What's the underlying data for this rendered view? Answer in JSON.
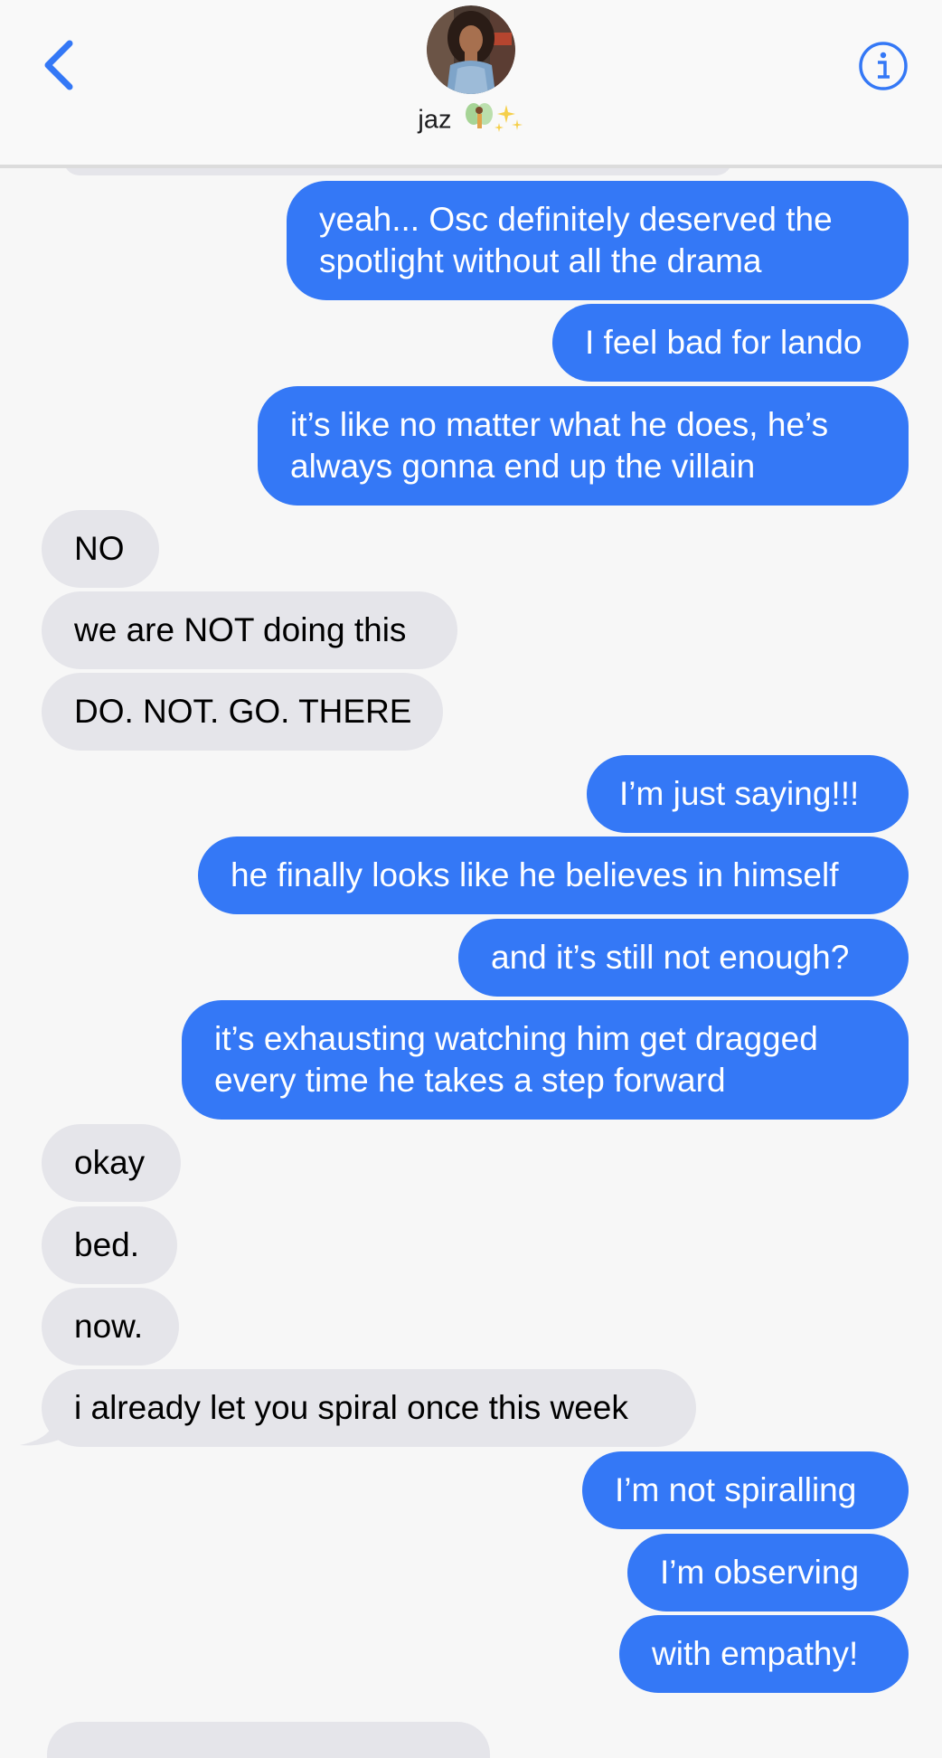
{
  "header": {
    "contact_name": "jaz",
    "name_emoji": "🧚✨",
    "back_icon": "chevron-left-icon",
    "info_icon": "info-circle-icon",
    "accent_color": "#3478f6"
  },
  "messages": [
    {
      "direction": "sent",
      "text": "yeah... Osc definitely deserved the spotlight without all the drama"
    },
    {
      "direction": "sent",
      "text": "I feel bad for lando"
    },
    {
      "direction": "sent",
      "text": "it’s like no matter what he does, he’s always gonna end up the villain"
    },
    {
      "direction": "received",
      "text": "NO"
    },
    {
      "direction": "received",
      "text": "we are NOT doing this"
    },
    {
      "direction": "received",
      "text": "DO. NOT. GO. THERE"
    },
    {
      "direction": "sent",
      "text": "I’m just saying!!!"
    },
    {
      "direction": "sent",
      "text": "he finally looks like he believes in himself"
    },
    {
      "direction": "sent",
      "text": "and it’s still not enough?"
    },
    {
      "direction": "sent",
      "text": "it’s exhausting watching him get dragged every time he takes a step forward"
    },
    {
      "direction": "received",
      "text": "okay"
    },
    {
      "direction": "received",
      "text": "bed."
    },
    {
      "direction": "received",
      "text": "now."
    },
    {
      "direction": "received",
      "text": "i already let you spiral once this week"
    },
    {
      "direction": "sent",
      "text": "I’m not spiralling"
    },
    {
      "direction": "sent",
      "text": "I’m observing"
    },
    {
      "direction": "sent",
      "text": "with empathy!"
    }
  ],
  "colors": {
    "sent_bubble": "#3478f6",
    "received_bubble": "#e5e5ea",
    "background": "#f7f7f7"
  }
}
